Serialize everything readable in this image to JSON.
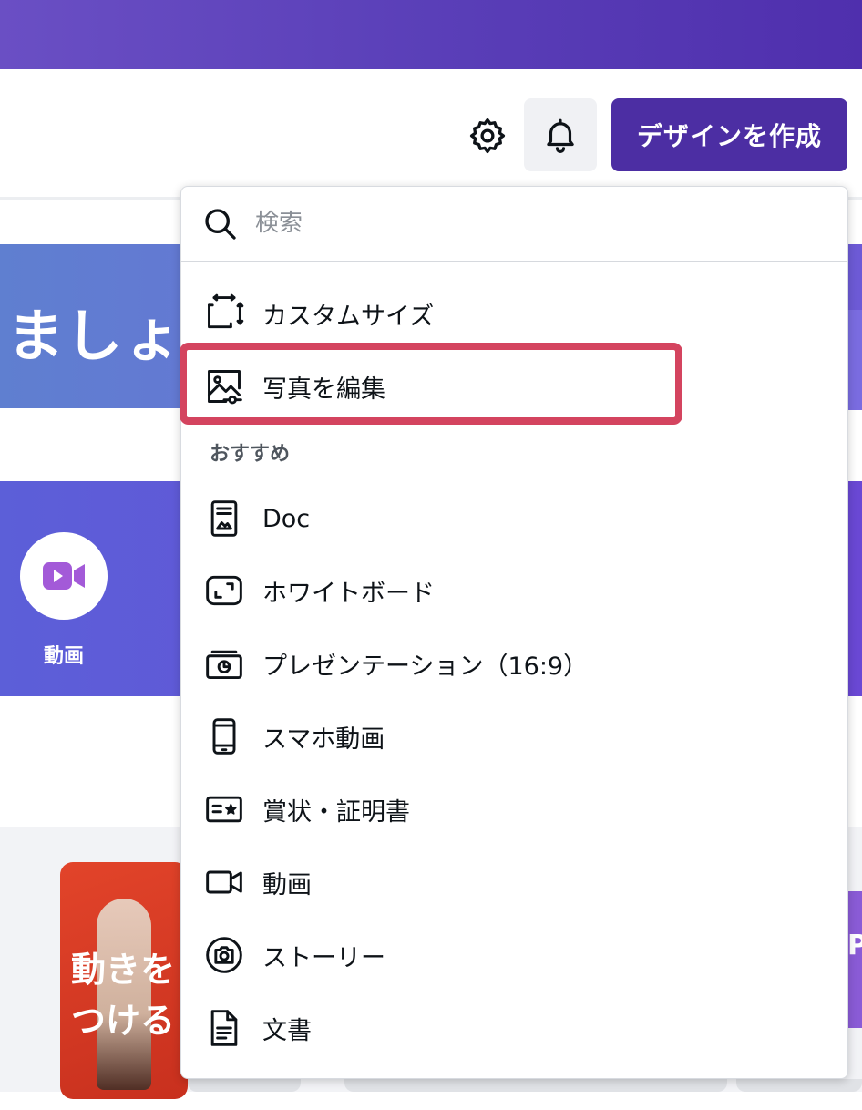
{
  "header": {
    "create_button": "デザインを作成"
  },
  "background": {
    "hero_text": "ましょ",
    "category_label": "動画",
    "thumb_text": "動きをつける",
    "thumb_right_text": "P"
  },
  "search": {
    "placeholder": "検索"
  },
  "menu": {
    "top_items": [
      {
        "label": "カスタムサイズ",
        "icon": "resize-icon"
      },
      {
        "label": "写真を編集",
        "icon": "edit-photo-icon"
      }
    ],
    "section_title": "おすすめ",
    "items": [
      {
        "label": "Doc",
        "icon": "doc-icon"
      },
      {
        "label": "ホワイトボード",
        "icon": "whiteboard-icon"
      },
      {
        "label": "プレゼンテーション（16:9）",
        "icon": "presentation-icon"
      },
      {
        "label": "スマホ動画",
        "icon": "phone-video-icon"
      },
      {
        "label": "賞状・証明書",
        "icon": "certificate-icon"
      },
      {
        "label": "動画",
        "icon": "video-icon"
      },
      {
        "label": "ストーリー",
        "icon": "story-icon"
      },
      {
        "label": "文書",
        "icon": "document-icon"
      }
    ]
  },
  "colors": {
    "brand": "#4c2ea3",
    "highlight": "#d4445f"
  }
}
